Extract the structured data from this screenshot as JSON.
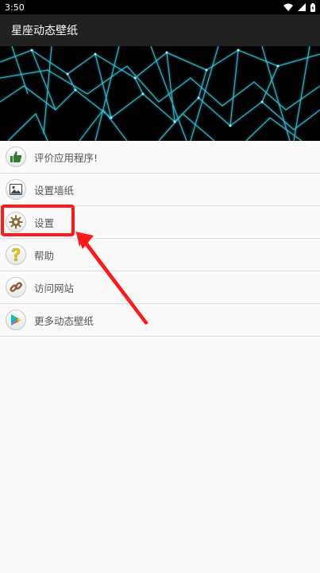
{
  "status_bar": {
    "time": "3:50"
  },
  "app_bar": {
    "title": "星座动态壁纸"
  },
  "menu": {
    "items": [
      {
        "label": "评价应用程序!",
        "icon": "thumbs-up-icon"
      },
      {
        "label": "设置墙纸",
        "icon": "image-icon"
      },
      {
        "label": "设置",
        "icon": "gear-icon"
      },
      {
        "label": "帮助",
        "icon": "question-icon"
      },
      {
        "label": "访问网站",
        "icon": "link-icon"
      },
      {
        "label": "更多动态壁纸",
        "icon": "play-store-icon"
      }
    ]
  },
  "colors": {
    "highlight": "#ff1a1a",
    "app_bar_bg": "#212121",
    "status_bar_bg": "#000000",
    "hero_lines": "#3fd3e8"
  }
}
